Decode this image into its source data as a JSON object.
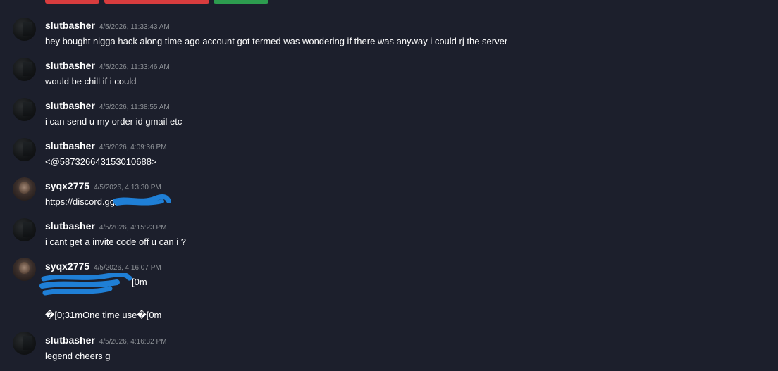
{
  "top_buttons": [
    {
      "color": "#d83c3e"
    },
    {
      "color": "#d83c3e"
    },
    {
      "color": "#2d9c4f"
    }
  ],
  "messages": [
    {
      "author": "slutbasher",
      "time": "4/5/2026, 11:33:43 AM",
      "text": "hey bought nigga hack along time ago account got termed was wondering if there was anyway i could rj the server",
      "avatar": "dark-avatar"
    },
    {
      "author": "slutbasher",
      "time": "4/5/2026, 11:33:46 AM",
      "text": "would be chill if i could",
      "avatar": "dark-avatar"
    },
    {
      "author": "slutbasher",
      "time": "4/5/2026, 11:38:55 AM",
      "text": "i can send u my order id gmail etc",
      "avatar": "dark-avatar"
    },
    {
      "author": "slutbasher",
      "time": "4/5/2026, 4:09:36 PM",
      "text": "<@587326643153010688>",
      "avatar": "dark-avatar"
    },
    {
      "author": "syqx2775",
      "time": "4/5/2026, 4:13:30 PM",
      "text": "https://discord.gg/",
      "avatar": "photo-avatar"
    },
    {
      "author": "slutbasher",
      "time": "4/5/2026, 4:15:23 PM",
      "text": "i cant get a invite code off u can i ?",
      "avatar": "dark-avatar"
    },
    {
      "author": "syqx2775",
      "time": "4/5/2026, 4:16:07 PM",
      "text": "[0m",
      "text2": "�[0;31mOne time use�[0m",
      "avatar": "photo-avatar"
    },
    {
      "author": "slutbasher",
      "time": "4/5/2026, 4:16:32 PM",
      "text": "legend cheers g",
      "avatar": "dark-avatar"
    }
  ],
  "redaction_color": "#1f7fd6"
}
